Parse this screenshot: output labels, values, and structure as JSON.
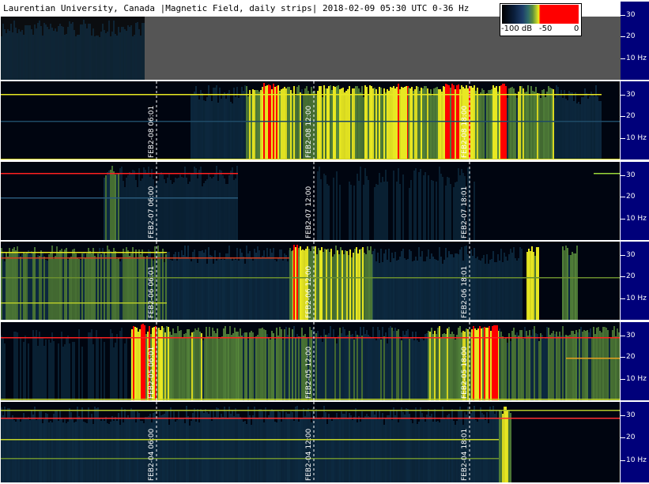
{
  "chart_data": {
    "type": "heatmap",
    "title": "Laurentian University, Canada |Magnetic Field, daily strips| 2018-02-09 05:30 UTC 0-36 Hz",
    "colorbar": {
      "labels": [
        "-100 dB",
        "-50",
        "0"
      ],
      "range_db": [
        -100,
        0
      ]
    },
    "y_axis": {
      "unit": "Hz",
      "range": [
        0,
        36
      ],
      "ticks": [
        30,
        20,
        10
      ],
      "tick_labels": [
        "30",
        "20",
        "10 Hz"
      ]
    },
    "x_axis": {
      "time_range_hours": [
        0,
        24
      ],
      "marker_hours": [
        6,
        12,
        18
      ]
    },
    "strips": [
      {
        "id": "header",
        "date_labels": []
      },
      {
        "id": "feb08",
        "date_labels": [
          "FEB2-08 06:01",
          "FEB2-08 12:00",
          "FEB2-08 18:00"
        ]
      },
      {
        "id": "feb07",
        "date_labels": [
          "FEB2-07 06:00",
          "FEB2-07 12:00",
          "FEB2-07 18:01"
        ]
      },
      {
        "id": "feb06",
        "date_labels": [
          "FEB2-06 06:01",
          "FEB2-06 12:00",
          "FEB2-06 18:01"
        ]
      },
      {
        "id": "feb05",
        "date_labels": [
          "FEB2-05 06:01",
          "FEB2-05 12:00",
          "FEB2-05 18:00"
        ]
      },
      {
        "id": "feb04",
        "date_labels": [
          "FEB2-04 06:00",
          "FEB2-04 12:00",
          "FEB2-04 18:01"
        ]
      }
    ],
    "colors": {
      "background": "#000510",
      "weak": "#123a55",
      "medium": "#5b8f3e",
      "strong": "#e8e822",
      "saturated": "#ff0000",
      "axis_bg": "#00007a",
      "header_gray": "#555555"
    }
  }
}
